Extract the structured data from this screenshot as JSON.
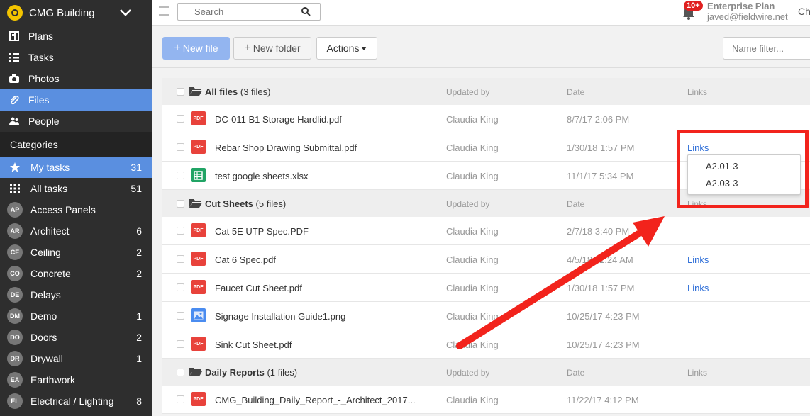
{
  "sidebar": {
    "project_name": "CMG Building",
    "nav": [
      {
        "label": "Plans",
        "icon": "plans-icon"
      },
      {
        "label": "Tasks",
        "icon": "tasks-icon"
      },
      {
        "label": "Photos",
        "icon": "camera-icon"
      },
      {
        "label": "Files",
        "icon": "paperclip-icon",
        "active": true
      },
      {
        "label": "People",
        "icon": "people-icon"
      }
    ],
    "categories_heading": "Categories",
    "categories": [
      {
        "badge": "",
        "label": "My tasks",
        "count": "31",
        "active": true
      },
      {
        "badge": "",
        "label": "All tasks",
        "count": "51"
      },
      {
        "badge": "AP",
        "label": "Access Panels",
        "count": ""
      },
      {
        "badge": "AR",
        "label": "Architect",
        "count": "6"
      },
      {
        "badge": "CE",
        "label": "Ceiling",
        "count": "2"
      },
      {
        "badge": "CO",
        "label": "Concrete",
        "count": "2"
      },
      {
        "badge": "DE",
        "label": "Delays",
        "count": ""
      },
      {
        "badge": "DM",
        "label": "Demo",
        "count": "1"
      },
      {
        "badge": "DO",
        "label": "Doors",
        "count": "2"
      },
      {
        "badge": "DR",
        "label": "Drywall",
        "count": "1"
      },
      {
        "badge": "EA",
        "label": "Earthwork",
        "count": ""
      },
      {
        "badge": "EL",
        "label": "Electrical / Lighting",
        "count": "8"
      }
    ]
  },
  "topbar": {
    "search_placeholder": "Search",
    "notification_count": "10+",
    "plan_name": "Enterprise Plan",
    "user_email": "javed@fieldwire.net",
    "truncated_text": "Ch"
  },
  "toolbar": {
    "new_file": "New file",
    "new_folder": "New folder",
    "actions": "Actions",
    "name_filter_placeholder": "Name filter..."
  },
  "columns": {
    "updated_by": "Updated by",
    "date": "Date",
    "links": "Links"
  },
  "groups": [
    {
      "title": "All files",
      "count": "(3 files)",
      "files": [
        {
          "type": "pdf",
          "name": "DC-011 B1 Storage Hardlid.pdf",
          "updated_by": "Claudia King",
          "date": "8/7/17 2:06 PM",
          "links": ""
        },
        {
          "type": "pdf",
          "name": "Rebar Shop Drawing Submittal.pdf",
          "updated_by": "Claudia King",
          "date": "1/30/18 1:57 PM",
          "links": "Links"
        },
        {
          "type": "sheet",
          "name": "test google sheets.xlsx",
          "updated_by": "Claudia King",
          "date": "11/1/17 5:34 PM",
          "links": ""
        }
      ]
    },
    {
      "title": "Cut Sheets",
      "count": "(5 files)",
      "files": [
        {
          "type": "pdf",
          "name": "Cat 5E UTP Spec.PDF",
          "updated_by": "Claudia King",
          "date": "2/7/18 3:40 PM",
          "links": ""
        },
        {
          "type": "pdf",
          "name": "Cat 6 Spec.pdf",
          "updated_by": "Claudia King",
          "date": "4/5/18 11:24 AM",
          "links": "Links"
        },
        {
          "type": "pdf",
          "name": "Faucet Cut Sheet.pdf",
          "updated_by": "Claudia King",
          "date": "1/30/18 1:57 PM",
          "links": "Links"
        },
        {
          "type": "img",
          "name": "Signage Installation Guide1.png",
          "updated_by": "Claudia King",
          "date": "10/25/17 4:23 PM",
          "links": ""
        },
        {
          "type": "pdf",
          "name": "Sink Cut Sheet.pdf",
          "updated_by": "Claudia King",
          "date": "10/25/17 4:23 PM",
          "links": ""
        }
      ]
    },
    {
      "title": "Daily Reports",
      "count": "(1 files)",
      "files": [
        {
          "type": "pdf",
          "name": "CMG_Building_Daily_Report_-_Architect_2017...",
          "updated_by": "Claudia King",
          "date": "11/22/17 4:12 PM",
          "links": ""
        }
      ]
    }
  ],
  "links_popover": {
    "items": [
      "A2.01-3",
      "A2.03-3"
    ]
  },
  "pdf_icon_text": "PDF",
  "colors": {
    "accent": "#5a8fe0",
    "annotation": "#f2231c",
    "link": "#2f6fd8",
    "sidebar": "#2e2e2e"
  }
}
